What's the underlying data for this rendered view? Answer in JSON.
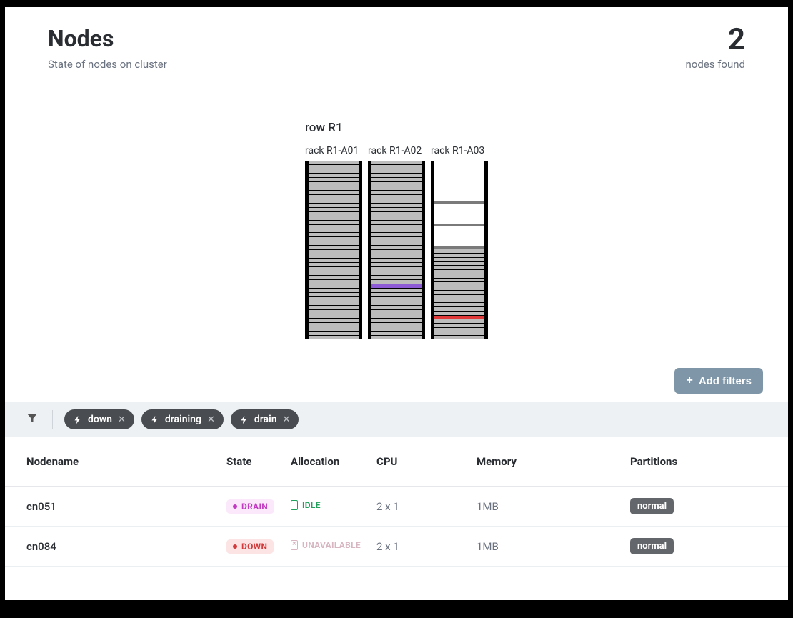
{
  "header": {
    "title": "Nodes",
    "subtitle": "State of nodes on cluster",
    "count": "2",
    "count_label": "nodes found"
  },
  "rack_diagram": {
    "row_label": "row R1",
    "racks": [
      {
        "label": "rack R1-A01",
        "pattern": [
          "slot",
          "slot",
          "slot",
          "slot",
          "slot",
          "slot",
          "slot",
          "slot",
          "slot",
          "slot",
          "slot",
          "slot",
          "slot",
          "slot",
          "slot",
          "slot",
          "slot",
          "slot",
          "slot",
          "slot",
          "slot",
          "slot",
          "slot",
          "slot",
          "slot",
          "slot",
          "slot",
          "slot",
          "slot",
          "slot",
          "slot",
          "slot",
          "slot",
          "slot",
          "slot",
          "slot",
          "slot",
          "slot",
          "slot",
          "slot",
          "slot",
          "slot"
        ]
      },
      {
        "label": "rack R1-A02",
        "pattern": [
          "slot",
          "slot",
          "slot",
          "slot",
          "slot",
          "slot",
          "slot",
          "slot",
          "slot",
          "slot",
          "slot",
          "slot",
          "slot",
          "slot",
          "slot",
          "slot",
          "slot",
          "slot",
          "slot",
          "slot",
          "slot",
          "slot",
          "slot",
          "slot",
          "slot",
          "slot",
          "slot",
          "slot",
          "slot",
          "purple",
          "slot",
          "slot",
          "slot",
          "slot",
          "slot",
          "slot",
          "slot",
          "slot",
          "slot",
          "slot",
          "slot",
          "slot"
        ]
      },
      {
        "label": "rack R1-A03",
        "pattern": [
          "empty",
          "empty",
          "empty",
          "empty",
          "empty",
          "empty",
          "empty",
          "empty",
          "empty",
          "empty-sep",
          "empty",
          "empty",
          "empty",
          "empty",
          "empty-sep",
          "empty",
          "empty",
          "empty",
          "empty",
          "empty-sep",
          "slot",
          "slot",
          "slot",
          "slot",
          "slot",
          "slot",
          "slot",
          "slot",
          "slot",
          "slot",
          "slot",
          "slot",
          "slot",
          "slot",
          "slot",
          "slot",
          "red",
          "slot",
          "slot",
          "slot",
          "slot",
          "slot"
        ]
      }
    ]
  },
  "actions": {
    "add_filters": "Add filters"
  },
  "filters": [
    {
      "label": "down"
    },
    {
      "label": "draining"
    },
    {
      "label": "drain"
    }
  ],
  "table": {
    "columns": {
      "nodename": "Nodename",
      "state": "State",
      "allocation": "Allocation",
      "cpu": "CPU",
      "memory": "Memory",
      "partitions": "Partitions"
    },
    "rows": [
      {
        "name": "cn051",
        "state_text": "DRAIN",
        "state_kind": "drain",
        "alloc_text": "IDLE",
        "alloc_kind": "idle",
        "cpu": "2 x 1",
        "memory": "1MB",
        "partition": "normal"
      },
      {
        "name": "cn084",
        "state_text": "DOWN",
        "state_kind": "down",
        "alloc_text": "UNAVAILABLE",
        "alloc_kind": "unavail",
        "cpu": "2 x 1",
        "memory": "1MB",
        "partition": "normal"
      }
    ]
  }
}
